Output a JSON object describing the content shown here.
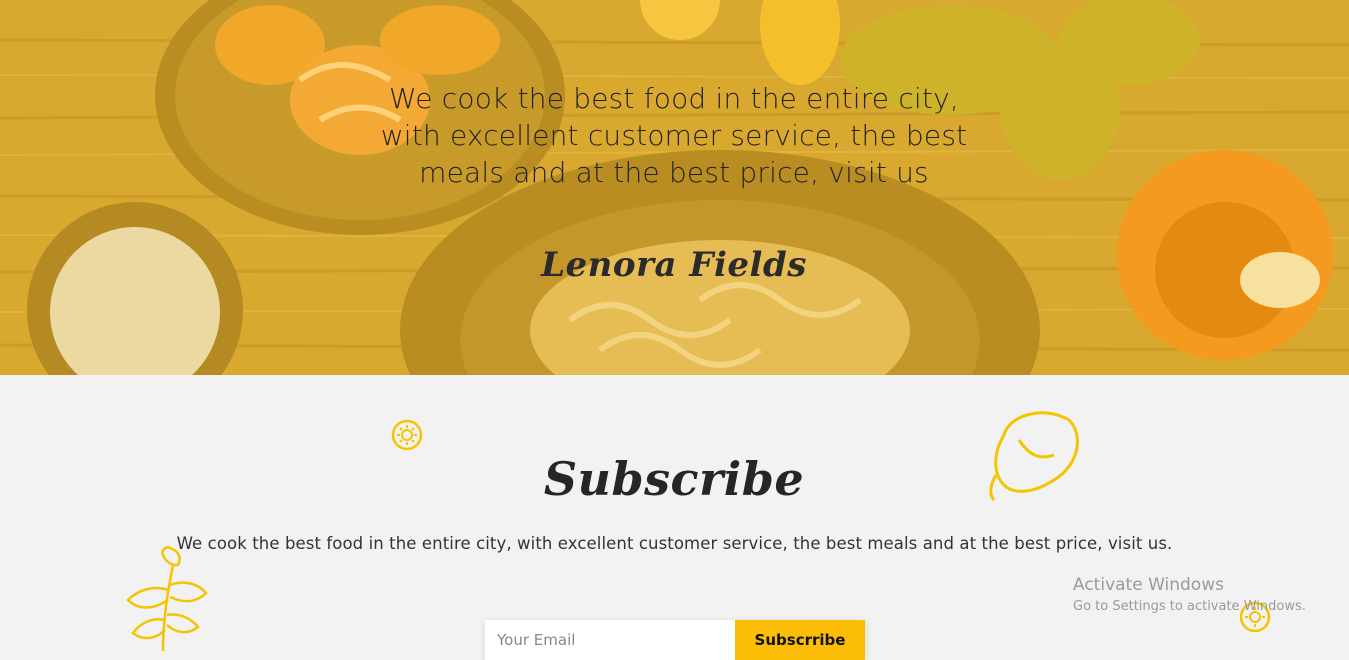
{
  "hero": {
    "quote": "We cook the best food in the entire city, with excellent customer service, the best meals and at the best price, visit us",
    "author": "Lenora Fields"
  },
  "subscribe": {
    "title": "Subscribe",
    "description": "We cook the best food in the entire city, with excellent customer service, the best meals and at the best price, visit us.",
    "email_placeholder": "Your Email",
    "button_label": "Subscrribe"
  },
  "doodles": [
    "sun-icon",
    "pepper-icon",
    "parsley-icon",
    "sun-icon"
  ],
  "watermark": {
    "title": "Activate Windows",
    "subtitle": "Go to Settings to activate Windows."
  },
  "colors": {
    "hero_tint": "#d8a52c",
    "accent": "#fbbd08",
    "page_bg": "#f2f2f2",
    "text_dark": "#222222"
  }
}
